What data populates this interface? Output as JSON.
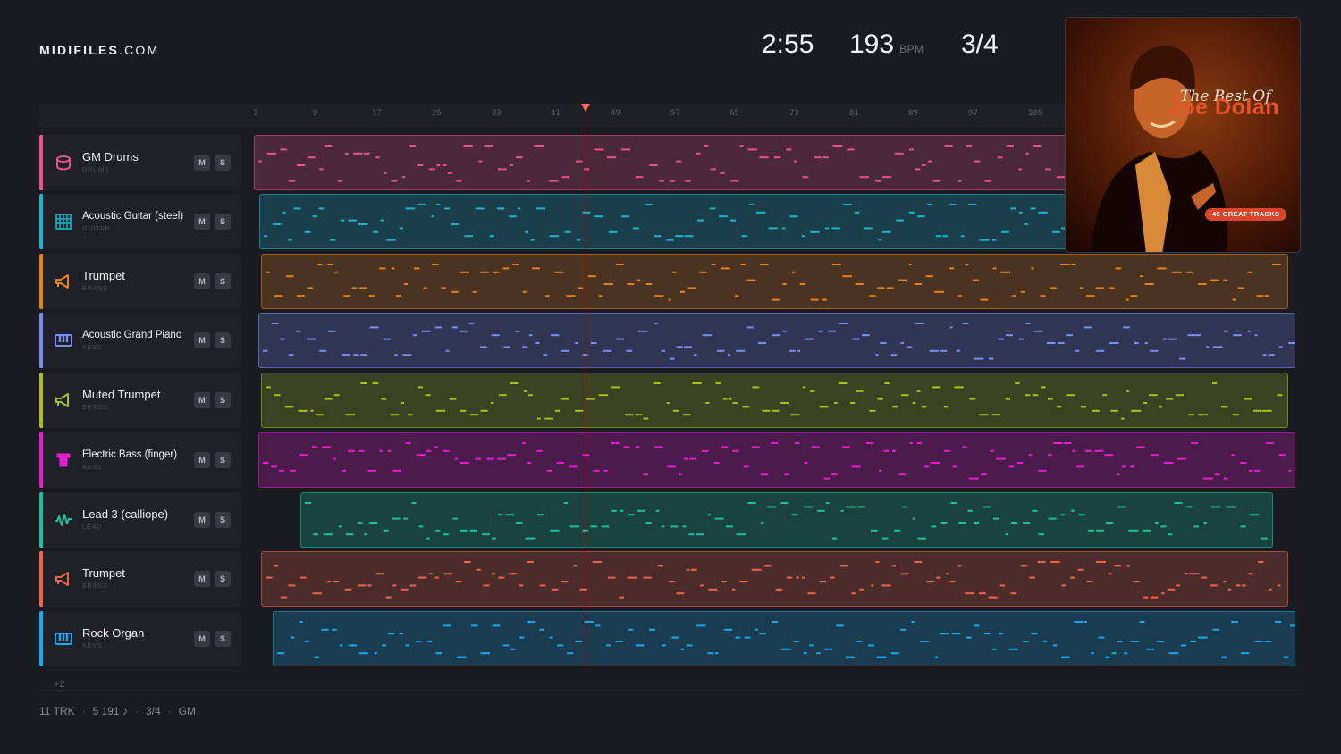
{
  "logo": {
    "bold": "MIDIFILES",
    "light": ".COM"
  },
  "header": {
    "time": "2:55",
    "bpm": "193",
    "bpm_unit": "BPM",
    "signature": "3/4"
  },
  "ruler": {
    "ticks": [
      "1",
      "9",
      "17",
      "25",
      "33",
      "41",
      "49",
      "57",
      "65",
      "73",
      "81",
      "89",
      "97",
      "105"
    ]
  },
  "tracks": [
    {
      "name": "GM Drums",
      "category": "DRUMS",
      "color": "#e8548a",
      "icon": "drum-icon",
      "mute": "M",
      "solo": "S"
    },
    {
      "name": "Acoustic Guitar (steel)",
      "category": "GUITAR",
      "color": "#1fb4cf",
      "icon": "guitar-icon",
      "mute": "M",
      "solo": "S"
    },
    {
      "name": "Trumpet",
      "category": "BRASS",
      "color": "#e8821e",
      "icon": "trumpet-icon",
      "mute": "M",
      "solo": "S"
    },
    {
      "name": "Acoustic Grand Piano",
      "category": "KEYS",
      "color": "#7b8cf2",
      "icon": "piano-icon",
      "mute": "M",
      "solo": "S"
    },
    {
      "name": "Muted Trumpet",
      "category": "BRASS",
      "color": "#a9c020",
      "icon": "trumpet-icon",
      "mute": "M",
      "solo": "S"
    },
    {
      "name": "Electric Bass (finger)",
      "category": "BASS",
      "color": "#e41ed0",
      "icon": "bass-icon",
      "mute": "M",
      "solo": "S"
    },
    {
      "name": "Lead 3 (calliope)",
      "category": "LEAD",
      "color": "#1fc0a0",
      "icon": "wave-icon",
      "mute": "M",
      "solo": "S"
    },
    {
      "name": "Trumpet",
      "category": "BRASS",
      "color": "#f0644c",
      "icon": "trumpet-icon",
      "mute": "M",
      "solo": "S"
    },
    {
      "name": "Rock Organ",
      "category": "KEYS",
      "color": "#1ea8ec",
      "icon": "organ-icon",
      "mute": "M",
      "solo": "S"
    }
  ],
  "more_tracks": "+2",
  "footer": {
    "tracks": "11 TRK",
    "notes": "5 191 ♪",
    "signature": "3/4",
    "standard": "GM"
  },
  "album": {
    "title_line1": "The Best Of",
    "title_line2": "Joe Dolan",
    "badge": "45 GREAT TRACKS"
  }
}
